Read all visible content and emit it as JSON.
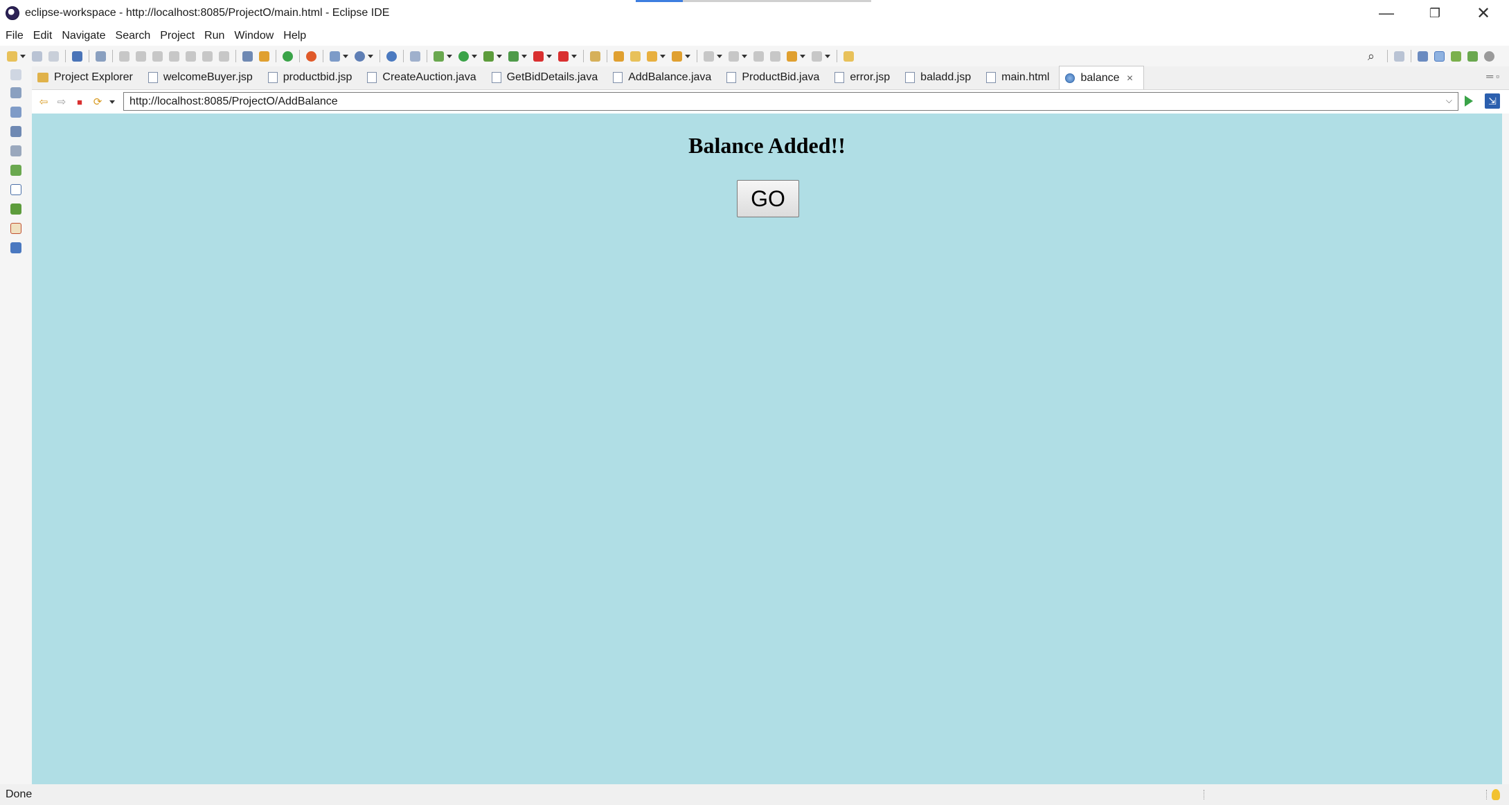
{
  "window": {
    "title": "eclipse-workspace - http://localhost:8085/ProjectO/main.html - Eclipse IDE",
    "controls": {
      "minimize": "—",
      "restore": "❐",
      "close": "✕"
    }
  },
  "menubar": {
    "items": [
      "File",
      "Edit",
      "Navigate",
      "Search",
      "Project",
      "Run",
      "Window",
      "Help"
    ]
  },
  "tabs": [
    {
      "label": "Project Explorer",
      "icon": "folder-icon"
    },
    {
      "label": "welcomeBuyer.jsp",
      "icon": "file-icon"
    },
    {
      "label": "productbid.jsp",
      "icon": "file-icon"
    },
    {
      "label": "CreateAuction.java",
      "icon": "java-file-icon"
    },
    {
      "label": "GetBidDetails.java",
      "icon": "java-file-icon"
    },
    {
      "label": "AddBalance.java",
      "icon": "java-file-icon"
    },
    {
      "label": "ProductBid.java",
      "icon": "java-file-icon"
    },
    {
      "label": "error.jsp",
      "icon": "file-icon"
    },
    {
      "label": "baladd.jsp",
      "icon": "file-icon"
    },
    {
      "label": "main.html",
      "icon": "file-icon"
    },
    {
      "label": "balance",
      "icon": "globe-icon",
      "active": true,
      "close": "✕"
    }
  ],
  "browser": {
    "url": "http://localhost:8085/ProjectO/AddBalance"
  },
  "page": {
    "heading": "Balance Added!!",
    "go_button": "GO",
    "background_color": "#b0dee5"
  },
  "status": {
    "text": "Done"
  }
}
